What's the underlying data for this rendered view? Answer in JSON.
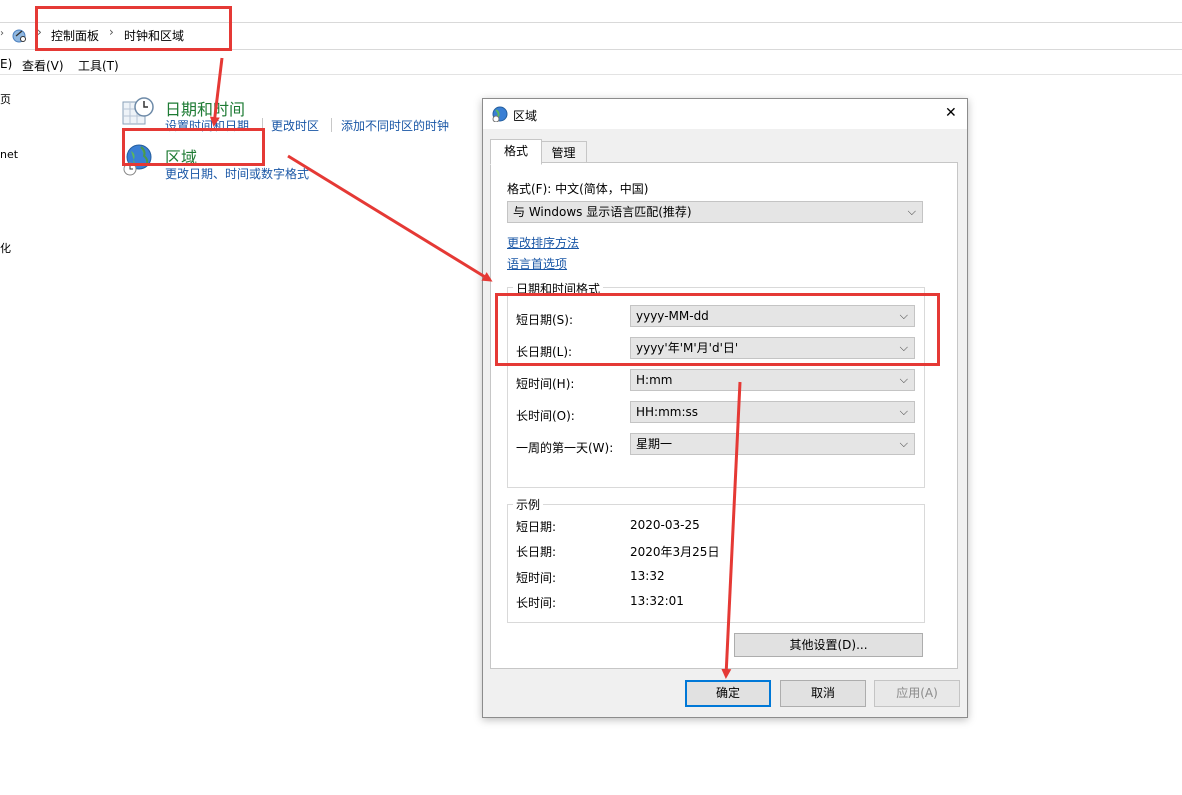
{
  "explorer": {
    "breadcrumb": [
      "控制面板",
      "时钟和区域"
    ],
    "menu": [
      "E)",
      "查看(V)",
      "工具(T)"
    ],
    "left_nav": [
      "页",
      "net",
      "化"
    ]
  },
  "categories": {
    "datetime": {
      "title": "日期和时间",
      "links": [
        "设置时间和日期",
        "更改时区",
        "添加不同时区的时钟"
      ]
    },
    "region": {
      "title": "区域",
      "links": [
        "更改日期、时间或数字格式"
      ]
    }
  },
  "dialog": {
    "title": "区域",
    "close": "✕",
    "tabs": [
      "格式",
      "管理"
    ],
    "format_label": "格式(F): 中文(简体，中国)",
    "format_value": "与 Windows 显示语言匹配(推荐)",
    "links": [
      "更改排序方法",
      "语言首选项"
    ],
    "datetime_group": "日期和时间格式",
    "fields": [
      {
        "label": "短日期(S):",
        "value": "yyyy-MM-dd"
      },
      {
        "label": "长日期(L):",
        "value": "yyyy'年'M'月'd'日'"
      },
      {
        "label": "短时间(H):",
        "value": "H:mm"
      },
      {
        "label": "长时间(O):",
        "value": "HH:mm:ss"
      },
      {
        "label": "一周的第一天(W):",
        "value": "星期一"
      }
    ],
    "example_group": "示例",
    "examples": [
      {
        "label": "短日期:",
        "value": "2020-03-25"
      },
      {
        "label": "长日期:",
        "value": "2020年3月25日"
      },
      {
        "label": "短时间:",
        "value": "13:32"
      },
      {
        "label": "长时间:",
        "value": "13:32:01"
      }
    ],
    "other_settings": "其他设置(D)...",
    "buttons": {
      "ok": "确定",
      "cancel": "取消",
      "apply": "应用(A)"
    }
  },
  "colors": {
    "annotation_red": "#e53935",
    "link_blue": "#1a57a6",
    "category_green": "#1e7b34",
    "accent": "#0078d7"
  },
  "icons": [
    "back-arrow-icon",
    "control-panel-icon",
    "chevron-right-icon",
    "clock-calendar-icon",
    "globe-clock-icon",
    "region-dialog-icon",
    "close-icon",
    "dropdown-chevron-icon"
  ]
}
